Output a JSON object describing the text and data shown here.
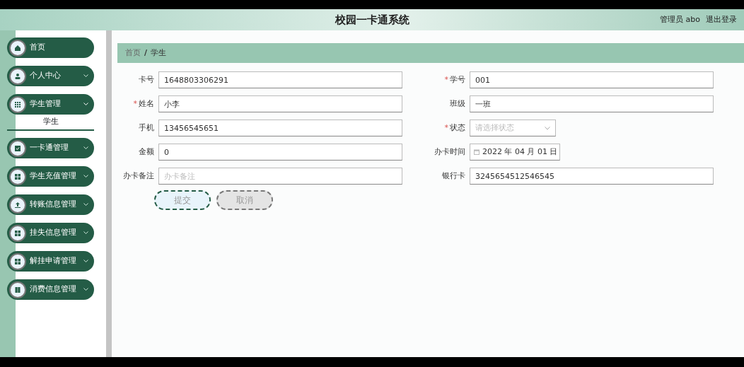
{
  "header": {
    "title": "校园一卡通系统",
    "user_role": "管理员",
    "user_name": "abo",
    "logout": "退出登录"
  },
  "sidebar": {
    "items": [
      {
        "label": "首页",
        "kind": "home",
        "expandable": false
      },
      {
        "label": "个人中心",
        "kind": "user",
        "expandable": true,
        "expanded": false
      },
      {
        "label": "学生管理",
        "kind": "grid9",
        "expandable": true,
        "expanded": true,
        "children": [
          {
            "label": "学生",
            "selected": true
          }
        ]
      },
      {
        "label": "一卡通管理",
        "kind": "check",
        "expandable": true,
        "expanded": false
      },
      {
        "label": "学生充值管理",
        "kind": "grid4",
        "expandable": true,
        "expanded": false
      },
      {
        "label": "转账信息管理",
        "kind": "upload",
        "expandable": true,
        "expanded": false
      },
      {
        "label": "挂失信息管理",
        "kind": "grid4",
        "expandable": true,
        "expanded": false
      },
      {
        "label": "解挂申请管理",
        "kind": "grid4",
        "expandable": true,
        "expanded": false
      },
      {
        "label": "消费信息管理",
        "kind": "book",
        "expandable": true,
        "expanded": false
      }
    ]
  },
  "breadcrumb": {
    "separator": "/",
    "items": [
      {
        "label": "首页"
      },
      {
        "label": "学生"
      }
    ]
  },
  "form": {
    "fields": [
      {
        "label": "卡号",
        "kind": "text",
        "value": "1648803306291"
      },
      {
        "label": "学号",
        "kind": "text",
        "required_mark": "*",
        "value": "001"
      },
      {
        "label": "姓名",
        "kind": "text",
        "required_mark": "*",
        "value": "小李"
      },
      {
        "label": "班级",
        "kind": "text",
        "value": "一班"
      },
      {
        "label": "手机",
        "kind": "text",
        "value": "13456545651"
      },
      {
        "label": "状态",
        "kind": "select",
        "required_mark": "*",
        "placeholder": "请选择状态"
      },
      {
        "label": "金额",
        "kind": "text",
        "value": "0"
      },
      {
        "label": "办卡时间",
        "kind": "date",
        "value": "2022 年 04 月 01 日"
      },
      {
        "label": "办卡备注",
        "kind": "text",
        "placeholder": "办卡备注"
      },
      {
        "label": "银行卡",
        "kind": "text",
        "value": "3245654512546545"
      }
    ],
    "buttons": [
      {
        "label": "提交",
        "kind": "primary"
      },
      {
        "label": "取消",
        "kind": "secondary"
      }
    ]
  }
}
